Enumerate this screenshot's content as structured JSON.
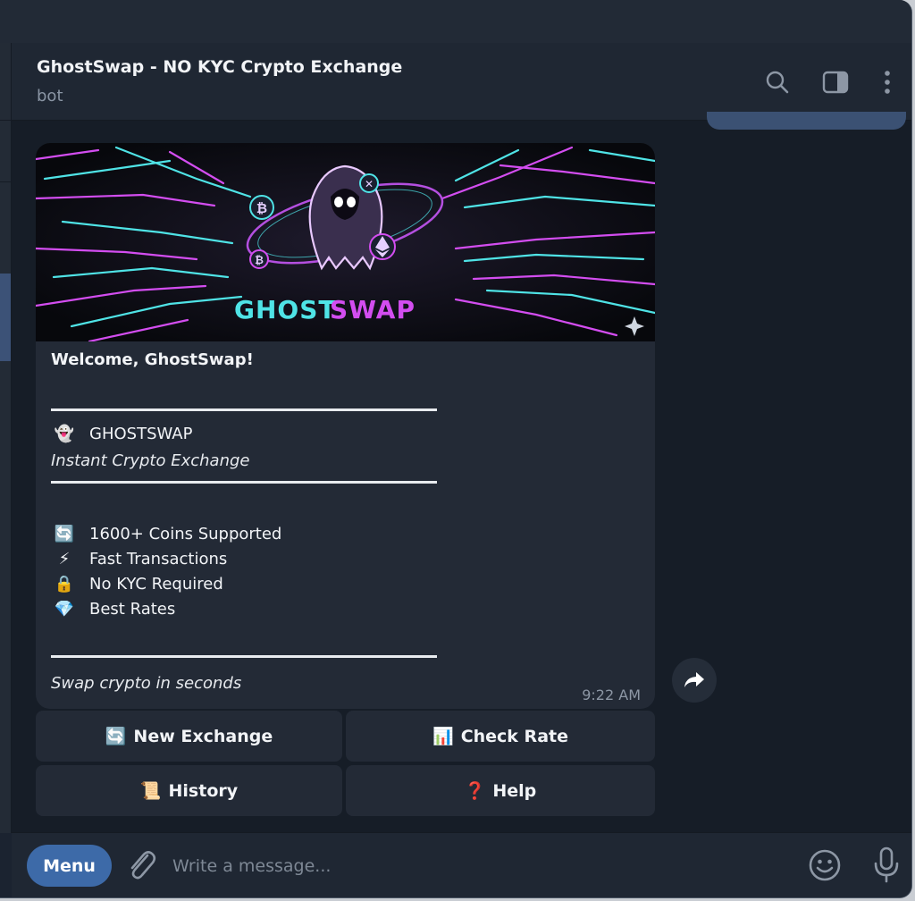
{
  "header": {
    "title": "GhostSwap - NO KYC Crypto Exchange",
    "subtitle": "bot"
  },
  "banner": {
    "logo_left": "GHOST",
    "logo_right": "SWAP"
  },
  "message": {
    "greeting": "Welcome, GhostSwap!",
    "brand_emoji": "👻",
    "brand": "GHOSTSWAP",
    "tagline": "Instant Crypto Exchange",
    "features": [
      {
        "emoji": "🔄",
        "text": "1600+ Coins Supported"
      },
      {
        "emoji": "⚡",
        "text": "Fast Transactions"
      },
      {
        "emoji": "🔒",
        "text": "No KYC Required"
      },
      {
        "emoji": "💎",
        "text": "Best Rates"
      }
    ],
    "footer": "Swap crypto in seconds",
    "time": "9:22 AM"
  },
  "keyboard": [
    {
      "emoji": "🔄",
      "label": "New Exchange"
    },
    {
      "emoji": "📊",
      "label": "Check Rate"
    },
    {
      "emoji": "📜",
      "label": "History"
    },
    {
      "emoji": "❓",
      "label": "Help"
    }
  ],
  "composer": {
    "menu_label": "Menu",
    "placeholder": "Write a message..."
  },
  "colors": {
    "accent": "#3d6aa8",
    "bubble": "#232a36",
    "background": "#161d27",
    "cyan": "#4fe3e6",
    "magenta": "#d34df0"
  }
}
